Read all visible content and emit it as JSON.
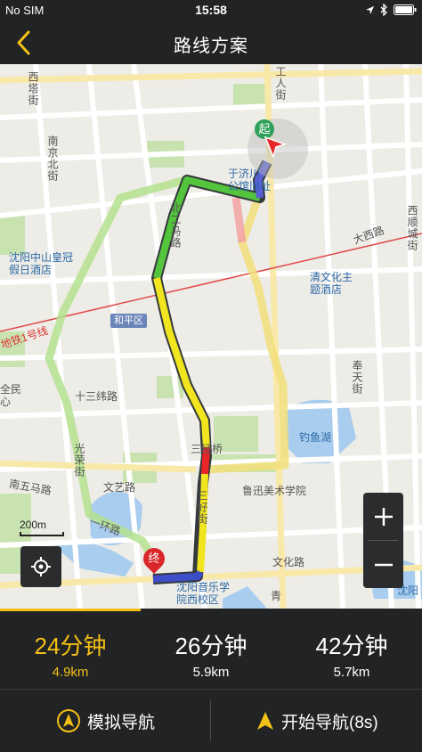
{
  "status": {
    "carrier": "No SIM",
    "time": "15:58"
  },
  "nav": {
    "title": "路线方案"
  },
  "map": {
    "labels": {
      "xita": "西塔街",
      "nanjing": "南京北街",
      "gongren": "工人街",
      "yujichuan": "于济川",
      "gongguan": "公馆旧址",
      "beier": "北二马路",
      "zhongshan": "沈阳中山皇冠假日酒店",
      "qingwenhua": "清文化主题酒店",
      "daxi": "大西路",
      "xishun": "西顺城街",
      "heping": "和平区",
      "metro": "地铁1号线",
      "shisanwei": "十三纬路",
      "quanmin": "全民心",
      "fengtian": "奉天街",
      "guangrong": "光荣街",
      "sanjing": "三经桥",
      "diaoyu": "钓鱼湖",
      "nanwuma": "南五马路",
      "wenyi": "文艺路",
      "luxun": "鲁迅美术学院",
      "sanhao": "三好街",
      "yihuan": "一环路",
      "wenhua": "文化路",
      "music": "沈阳音乐学院西校区",
      "music_r": "沈阳",
      "qing": "青"
    },
    "start_marker": "起",
    "end_marker": "终",
    "scale": "200m"
  },
  "routes": [
    {
      "duration": "24分钟",
      "distance": "4.9km",
      "active": true
    },
    {
      "duration": "26分钟",
      "distance": "5.9km",
      "active": false
    },
    {
      "duration": "42分钟",
      "distance": "5.7km",
      "active": false
    }
  ],
  "actions": {
    "simulate": "模拟导航",
    "start": "开始导航(8s)"
  },
  "colors": {
    "accent": "#f3c015",
    "background": "#222325"
  }
}
